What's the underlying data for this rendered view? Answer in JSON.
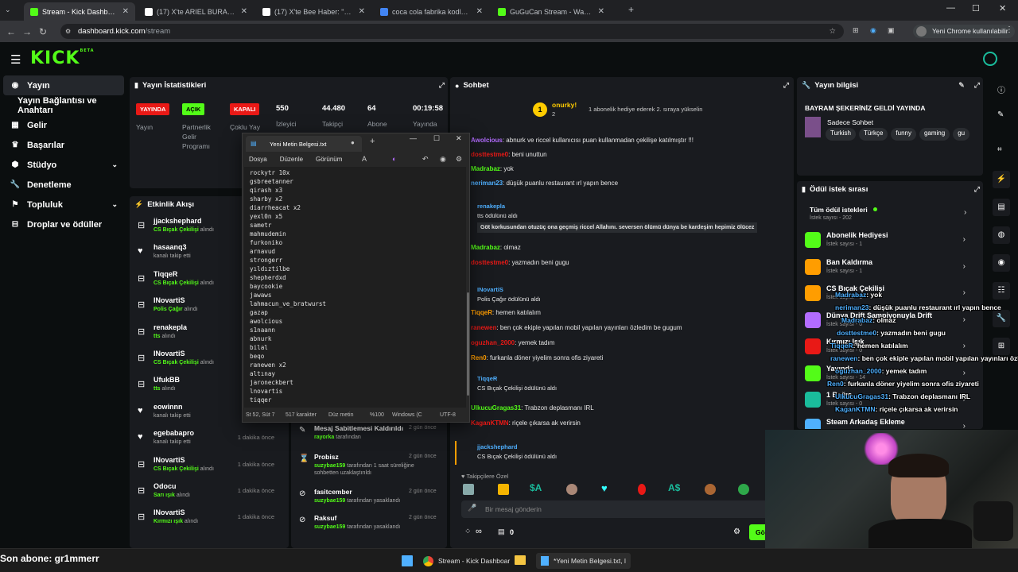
{
  "browser": {
    "tabs": [
      {
        "label": "Stream - Kick Dashboard",
        "active": true,
        "color": "#53fc18"
      },
      {
        "label": "(17) X'te ARIEL BURAK KAPLAN",
        "active": false,
        "color": "#ffffff"
      },
      {
        "label": "(17) X'te Bee Haber: \"Arabistan",
        "active": false,
        "color": "#ffffff"
      },
      {
        "label": "coca cola fabrika kodları - Goo",
        "active": false,
        "color": "#4285f4"
      },
      {
        "label": "GuGuCan Stream - Watch Live",
        "active": false,
        "color": "#53fc18"
      }
    ],
    "url_host": "dashboard.kick.com",
    "url_path": "/stream",
    "profile_label": "Yeni Chrome kullanılabilir"
  },
  "kick": {
    "logo": "KICK",
    "logo_sup": "BETA",
    "sidebar": [
      {
        "label": "Yayın",
        "icon": "broadcast-icon",
        "selected": true,
        "chev": false,
        "indent": false
      },
      {
        "label": "Yayın Bağlantısı ve Anahtarı",
        "icon": "",
        "selected": false,
        "chev": false,
        "indent": true
      },
      {
        "label": "Gelir",
        "icon": "chart-icon",
        "selected": false,
        "chev": false,
        "indent": false
      },
      {
        "label": "Başarılar",
        "icon": "trophy-icon",
        "selected": false,
        "chev": false,
        "indent": false
      },
      {
        "label": "Stüdyo",
        "icon": "studio-icon",
        "selected": false,
        "chev": true,
        "indent": false
      },
      {
        "label": "Denetleme",
        "icon": "wrench-icon",
        "selected": false,
        "chev": false,
        "indent": false
      },
      {
        "label": "Topluluk",
        "icon": "community-icon",
        "selected": false,
        "chev": true,
        "indent": false
      },
      {
        "label": "Droplar ve ödüller",
        "icon": "gift-icon",
        "selected": false,
        "chev": false,
        "indent": false
      }
    ],
    "stats": {
      "title": "Yayın İstatistikleri",
      "badges": [
        {
          "badge": "YAYINDA",
          "bg": "#e91916",
          "fg": "#ffffff",
          "label": "Yayın"
        },
        {
          "badge": "AÇIK",
          "bg": "#53fc18",
          "fg": "#000000",
          "label": "Partnerlik Gelir Programı"
        },
        {
          "badge": "KAPALI",
          "bg": "#e91916",
          "fg": "#ffffff",
          "label": "Çoklu Yay"
        }
      ],
      "values": [
        {
          "value": "550",
          "label": "İzleyici"
        },
        {
          "value": "44.480",
          "label": "Takipçi"
        },
        {
          "value": "64",
          "label": "Abone"
        },
        {
          "value": "00:19:58",
          "label": "Yayında"
        }
      ]
    },
    "activity": {
      "title": "Etkinlik Akışı",
      "items": [
        {
          "name": "jjackshephard",
          "accent": "CS Bıçak Çekilişi",
          "desc": "alındı",
          "time": "",
          "icon": "gift-icon"
        },
        {
          "name": "hasaanq3",
          "accent": "",
          "desc": "kanalı takip etti",
          "time": "",
          "icon": "heart-icon"
        },
        {
          "name": "TiqqeR",
          "accent": "CS Bıçak Çekilişi",
          "desc": "alındı",
          "time": "",
          "icon": "gift-icon"
        },
        {
          "name": "INovartiS",
          "accent": "Polis Çağır",
          "desc": "alındı",
          "time": "",
          "icon": "gift-icon"
        },
        {
          "name": "renakepla",
          "accent": "tts",
          "desc": "alındı",
          "time": "",
          "icon": "gift-icon"
        },
        {
          "name": "INovartiS",
          "accent": "CS Bıçak Çekilişi",
          "desc": "alındı",
          "time": "",
          "icon": "gift-icon"
        },
        {
          "name": "UfukBB",
          "accent": "tts",
          "desc": "alındı",
          "time": "",
          "icon": "gift-icon"
        },
        {
          "name": "eowinnn",
          "accent": "",
          "desc": "kanalı takip etti",
          "time": "",
          "icon": "heart-icon"
        },
        {
          "name": "egebabapro",
          "accent": "",
          "desc": "kanalı takip etti",
          "time": "1 dakika önce",
          "icon": "heart-icon"
        },
        {
          "name": "INovartiS",
          "accent": "CS Bıçak Çekilişi",
          "desc": "alındı",
          "time": "1 dakika önce",
          "icon": "gift-icon"
        },
        {
          "name": "Odocu",
          "accent": "Sarı ışık",
          "desc": "alındı",
          "time": "1 dakika önce",
          "icon": "gift-icon"
        },
        {
          "name": "INovartiS",
          "accent": "Kırmızı ışık",
          "desc": "alındı",
          "time": "1 dakika önce",
          "icon": "gift-icon"
        }
      ]
    },
    "moderation": [
      {
        "title": "Mesaj Sabitlemesi Kaldırıldı",
        "user": "rayorka",
        "desc": "tarafından",
        "time": "2 gün önce",
        "icon": "pin-icon"
      },
      {
        "title": "Probisz",
        "user": "suzybae159",
        "desc": "tarafından 1 saat süreliğine sohbetten uzaklaştırıldı",
        "time": "2 gün önce",
        "icon": "hourglass-icon"
      },
      {
        "title": "fasitcember",
        "user": "suzybae159",
        "desc": "tarafından yasaklandı",
        "time": "2 gün önce",
        "icon": "ban-icon"
      },
      {
        "title": "Raksuf",
        "user": "suzybae159",
        "desc": "tarafından yasaklandı",
        "time": "2 gün önce",
        "icon": "ban-icon"
      }
    ],
    "chat": {
      "title": "Sohbet",
      "pinned_user": "onurky!",
      "pinned_count": "2",
      "pinned_text": "1 abonelik hediye ederek 2. sıraya yükselin",
      "messages": [
        {
          "user": "Awolcious",
          "ucolor": "#b36cff",
          "text": ": abnurk ve riccel kullanıcısı puan kullanmadan çekilişe katılmıştır !!!"
        },
        {
          "user": "dosttestme0",
          "ucolor": "#e91916",
          "text": ": beni unuttun"
        },
        {
          "user": "Madrabaz",
          "ucolor": "#53fc18",
          "text": ": yok"
        },
        {
          "user": "neriman23",
          "ucolor": "#4fb0ff",
          "text": ": düşük puanlu restaurant ırl yapın bence"
        },
        {
          "user": "Madrabaz",
          "ucolor": "#53fc18",
          "text": ": olmaz"
        },
        {
          "user": "dosttestme0",
          "ucolor": "#e91916",
          "text": ": yazmadın beni gugu"
        },
        {
          "user": "TiqqeR",
          "ucolor": "#ff9d00",
          "text": ": hemen katılalım"
        },
        {
          "user": "ranewen",
          "ucolor": "#e91916",
          "text": ": ben çok ekiple yapılan mobil yapılan yayınları özledim be gugum"
        },
        {
          "user": "oguzhan_2000",
          "ucolor": "#e91916",
          "text": ": yemek tadım"
        },
        {
          "user": "Ren0",
          "ucolor": "#ff9d00",
          "text": ": furkanla döner yiyelim sonra ofis ziyareti"
        },
        {
          "user": "UlkucuGragas31",
          "ucolor": "#53fc18",
          "text": ": Trabzon deplasmanı IRL"
        },
        {
          "user": "KaganKTMN",
          "ucolor": "#e91916",
          "text": ": riçele çıkarsa ak verirsin"
        }
      ],
      "rewards": [
        {
          "user": "renakepla",
          "line1": "tts ödülünü aldı",
          "line2": "Göt korkusundan otuzüç ona geçmiş riccel Allahını. seversen ölümü dünya be kardeşim hepimiz ölücez"
        },
        {
          "user": "INovartiS",
          "line1": "Polis Çağır ödülünü aldı",
          "line2": ""
        },
        {
          "user": "TiqqeR",
          "line1": "CS Bıçak Çekilişi ödülünü aldı",
          "line2": ""
        },
        {
          "user": "jjackshephard",
          "line1": "CS Bıçak Çekilişi ödülünü aldı",
          "line2": ""
        }
      ],
      "followers_label": "Takipçilere Özel",
      "input_placeholder": "Bir mesaj gönderin",
      "infinity": "∞",
      "zero": "0",
      "send_label": "Gön"
    },
    "info": {
      "title": "Yayın bilgisi",
      "stream_title": "BAYRAM ŞEKERİNİZ GELDİ YAYINDA",
      "category": "Sadece Sohbet",
      "tags": [
        "Turkish",
        "Türkçe",
        "funny",
        "gaming",
        "gu"
      ]
    },
    "rewards_queue": {
      "title": "Ödül istek sırası",
      "all_label": "Tüm ödül istekleri",
      "all_count": "İstek sayısı - 202",
      "items": [
        {
          "title": "Abonelik Hediyesi",
          "count": "İstek sayısı - 1",
          "color": "#53fc18"
        },
        {
          "title": "Ban Kaldırma",
          "count": "İstek sayısı - 1",
          "color": "#ff9d00"
        },
        {
          "title": "CS Bıçak Çekilişi",
          "count": "İstek sayısı - 1",
          "color": "#ff9d00"
        },
        {
          "title": "Dünya Drift Şampiyonuyla Drift",
          "count": "İstek sayısı - 0",
          "color": "#b36cff"
        },
        {
          "title": "Kırmızı Işık",
          "count": "İstek sayısı - 0",
          "color": "#e91916"
        },
        {
          "title": "Yayında ...",
          "count": "İstek sayısı - 14",
          "color": "#53fc18"
        },
        {
          "title": "1 Bağış ...",
          "count": "İstek sayısı - 0",
          "color": "#1abc9c"
        },
        {
          "title": "Steam Arkadaş Ekleme",
          "count": "",
          "color": "#4fb0ff"
        }
      ]
    }
  },
  "notepad": {
    "title": "Yeni Metin Belgesi.txt",
    "menu": [
      "Dosya",
      "Düzenle",
      "Görünüm"
    ],
    "lines": [
      "rockytr 10x",
      "gsbreetanner",
      "qirash x3",
      "sharby x2",
      "diarrheacat x2",
      "yexl0n x5",
      "sametr",
      "mahmudemin",
      "furkoniko",
      "arnavud",
      "strongerr",
      "yıldıztilbe",
      "shepherdxd",
      "baycookie",
      "jawaws",
      "lahmacun_ve_bratwurst",
      "gazap",
      "awolcious",
      "s1naann",
      "abnurk",
      "bilal",
      "beqo",
      "ranewen x2",
      "altınay",
      "jaroneckbert",
      "lnovartis",
      "tiqqer"
    ],
    "status": [
      "St 52, Süt 7",
      "517 karakter",
      "Düz metin",
      "%100",
      "Windows (C",
      "UTF-8"
    ]
  },
  "overlay_chat": [
    {
      "user": "Madrabaz",
      "text": ": yok"
    },
    {
      "user": "neriman23",
      "text": ": düşük puanlu restaurant ırl yapın bence"
    },
    {
      "user": "Madrabaz",
      "text": ": olmaz"
    },
    {
      "user": "dosttestme0",
      "text": ": yazmadın beni gugu"
    },
    {
      "user": "TiqqeR",
      "text": ": hemen katılalım"
    },
    {
      "user": "ranewen",
      "text": ": ben çok ekiple yapılan mobil yapılan yayınları özledim be gugum"
    },
    {
      "user": "oguzhan_2000",
      "text": ": yemek tadım"
    },
    {
      "user": "Ren0",
      "text": ": furkanla döner yiyelim sonra ofis ziyareti"
    },
    {
      "user": "UlkucuGragas31",
      "text": ": Trabzon deplasmanı IRL"
    },
    {
      "user": "KaganKTMN",
      "text": ": riçele çıkarsa ak verirsin"
    }
  ],
  "bottom_bar": {
    "last_sub": "Son abone: gr1mmerr"
  },
  "taskbar": {
    "items": [
      "Stream - Kick Dashboar",
      "*Yeni Metin Belgesi.txt, l"
    ]
  }
}
